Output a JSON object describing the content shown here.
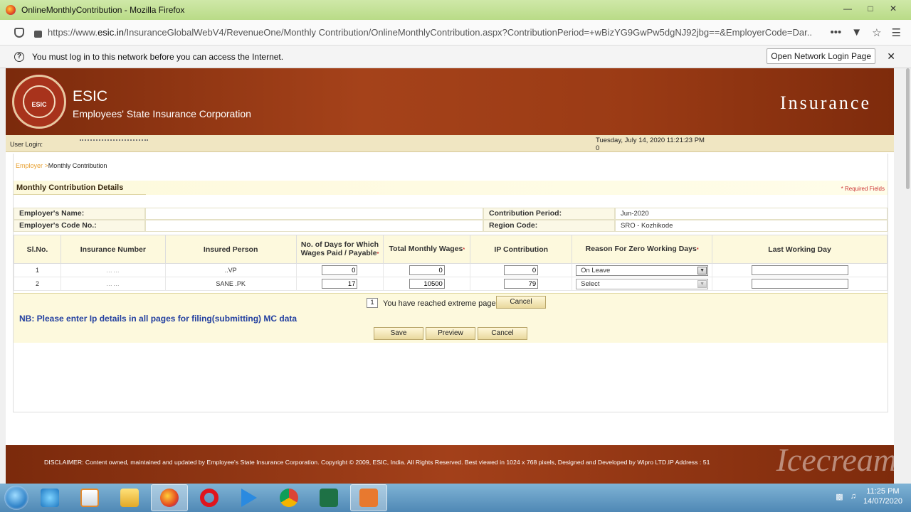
{
  "window": {
    "title": "OnlineMonthlyContribution - Mozilla Firefox"
  },
  "browser": {
    "url_prefix": "https://www.",
    "url_domain": "esic.in",
    "url_path": "/InsuranceGlobalWebV4/RevenueOne/Monthly Contribution/OnlineMonthlyContribution.aspx?ContributionPeriod=+wBizYG9GwPw5dgNJ92jbg==&EmployerCode=Dar..."
  },
  "notice": {
    "message": "You must log in to this network before you can access the Internet.",
    "button": "Open Network Login Page"
  },
  "header": {
    "short": "ESIC",
    "full": "Employees' State Insurance Corporation",
    "brand": "Insurance",
    "logo_text": "ESIC"
  },
  "userbar": {
    "label": "User Login:",
    "datetime": "Tuesday, July 14, 2020 11:21:23 PM",
    "counter": "0"
  },
  "breadcrumb": {
    "root": "Employer",
    "current": "Monthly Contribution"
  },
  "section": {
    "title": "Monthly Contribution Details",
    "required": "* Required Fields"
  },
  "info": {
    "employer_name_label": "Employer's Name:",
    "employer_code_label": "Employer's Code No.:",
    "period_label": "Contribution Period:",
    "period_value": "Jun-2020",
    "region_label": "Region Code:",
    "region_value": "SRO - Kozhikode"
  },
  "table": {
    "headers": {
      "sl": "Sl.No.",
      "insurance": "Insurance Number",
      "person": "Insured Person",
      "days": "No. of Days for Which Wages Paid / Payable",
      "wages": "Total Monthly Wages",
      "ip": "IP Contribution",
      "reason": "Reason For Zero Working Days",
      "lwd": "Last Working Day"
    },
    "rows": [
      {
        "sl": "1",
        "person": "..VP",
        "days": "0",
        "wages": "0",
        "ip": "0",
        "reason": "On Leave"
      },
      {
        "sl": "2",
        "person": "SANE .PK",
        "days": "17",
        "wages": "10500",
        "ip": "79",
        "reason": "Select"
      }
    ]
  },
  "pager": {
    "page": "1",
    "message": "You have reached extreme page",
    "cancel": "Cancel"
  },
  "note": "NB: Please enter Ip details in all pages for filing(submitting) MC data",
  "actions": {
    "save": "Save",
    "preview": "Preview",
    "cancel": "Cancel"
  },
  "footer": {
    "disclaimer": "DISCLAIMER: Content owned, maintained and updated by Employee's State Insurance Corporation. Copyright © 2009, ESIC, India. All Rights Reserved. Best viewed in 1024 x 768 pixels, Designed and Developed by Wipro LTD.IP Address : 51",
    "watermark": "Icecream"
  },
  "taskbar": {
    "time": "11:25 PM",
    "date": "14/07/2020"
  },
  "colors": {
    "banner": "#9b3b15",
    "header_bg": "#fdf9dd",
    "note_text": "#2340a0"
  }
}
